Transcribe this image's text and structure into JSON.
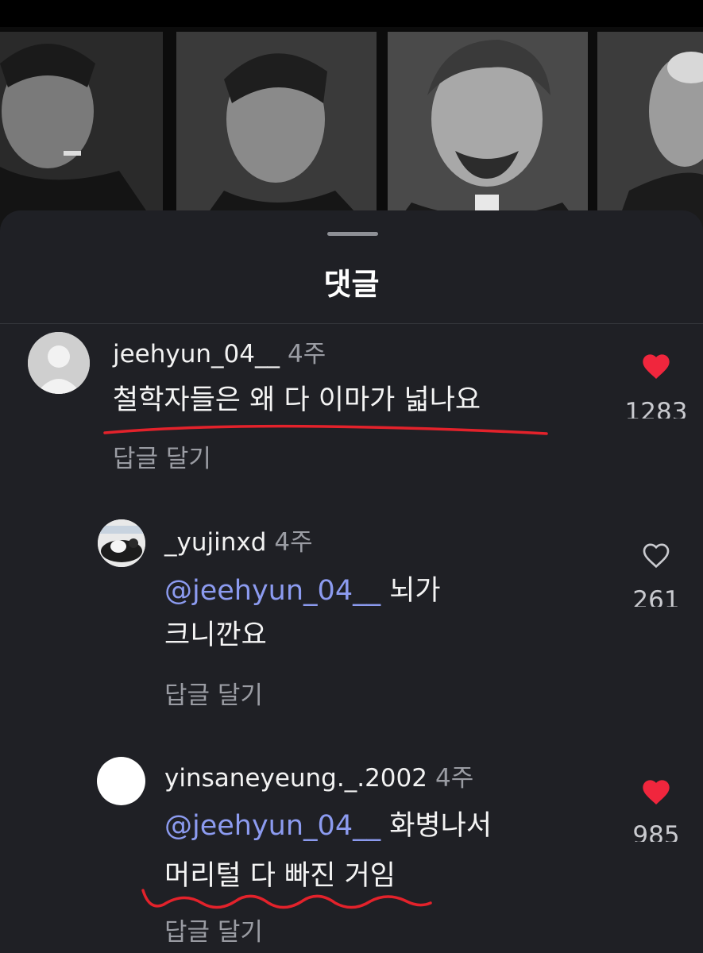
{
  "sheet": {
    "title": "댓글"
  },
  "comments": [
    {
      "username": "jeehyun_04__",
      "time": "4주",
      "lines": [
        "철학자들은 왜 다 이마가 넓나요"
      ],
      "reply_label": "답글 달기",
      "likes": "1283",
      "liked": true
    },
    {
      "username": "_yujinxd",
      "time": "4주",
      "mention": "@jeehyun_04__",
      "line1_rest": " 뇌가",
      "line2": "크니깐요",
      "reply_label": "답글 달기",
      "likes": "261",
      "liked": false
    },
    {
      "username": "yinsaneyeung._.2002",
      "time": "4주",
      "mention": "@jeehyun_04__",
      "line1_rest": " 화병나서",
      "line2": "머리털 다 빠진 거임",
      "reply_label": "답글 달기",
      "likes": "985",
      "liked": true
    }
  ],
  "colors": {
    "background": "#1f2025",
    "like_red": "#f0263d",
    "mention_blue": "#8c9bf0",
    "annotation_red": "#e3222b"
  }
}
